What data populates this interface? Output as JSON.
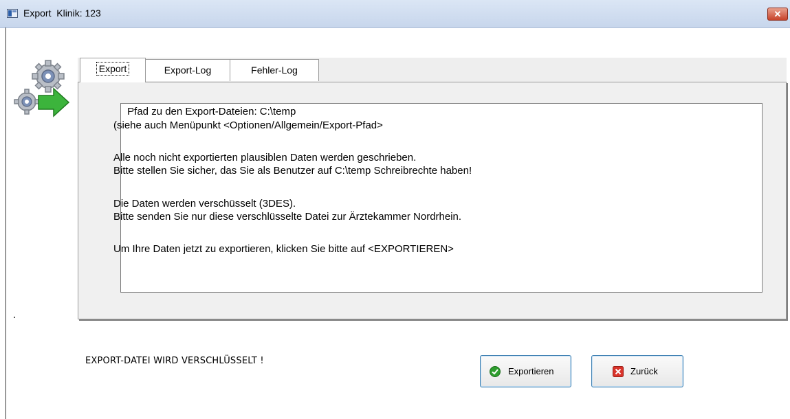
{
  "window": {
    "title": "Export  Klinik: 123",
    "close_label": "✕"
  },
  "tabs": [
    {
      "label": "Export",
      "active": true
    },
    {
      "label": "Export-Log",
      "active": false
    },
    {
      "label": "Fehler-Log",
      "active": false
    }
  ],
  "info": {
    "lines": [
      " Pfad zu den Export-Dateien: C:\\temp",
      "(siehe auch Menüpunkt <Optionen/Allgemein/Export-Pfad>",
      "Alle noch nicht exportierten plausiblen Daten werden geschrieben.",
      "Bitte stellen Sie sicher, das Sie als Benutzer auf C:\\temp Schreibrechte haben!",
      "Die Daten werden verschüsselt (3DES).",
      "Bitte senden Sie nur diese verschlüsselte Datei zur Ärztekammer Nordrhein.",
      "Um Ihre Daten jetzt zu exportieren, klicken Sie bitte auf <EXPORTIEREN>"
    ]
  },
  "status_text": "EXPORT-DATEI WIRD VERSCHLÜSSELT !",
  "buttons": {
    "export_label": "Exportieren",
    "back_label": "Zurück"
  },
  "icons": {
    "app": "window-app-icon",
    "export": "gear-export-arrow-icon",
    "export_button": "green-check-icon",
    "back_button": "red-x-icon"
  },
  "colors": {
    "titlebar": "#c7d6ec",
    "close_button": "#c7432a",
    "panel_bg": "#f0f0f0",
    "button_border": "#3c7fb1",
    "check_green": "#2e9e2e",
    "x_red": "#d9342b"
  }
}
